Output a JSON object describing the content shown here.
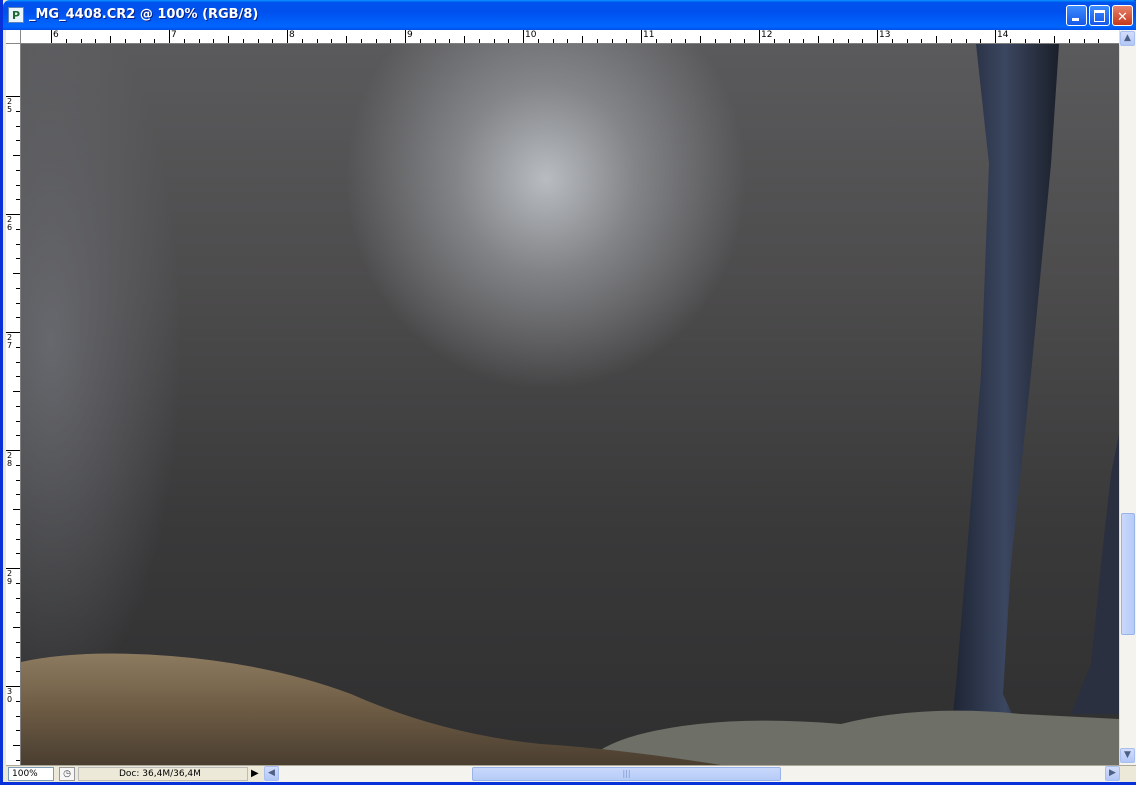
{
  "window": {
    "title": "_MG_4408.CR2 @ 100% (RGB/8)",
    "app_icon": "photoshop-document-icon",
    "buttons": {
      "minimize": "minimize-icon",
      "maximize": "maximize-icon",
      "close": "close-icon"
    }
  },
  "rulers": {
    "horizontal_labels": [
      "6",
      "7",
      "8",
      "9",
      "10",
      "11",
      "12",
      "13",
      "14"
    ],
    "vertical_labels": [
      "25",
      "26",
      "27",
      "28",
      "29",
      "30"
    ]
  },
  "canvas": {
    "image_description": "photo"
  },
  "status_bar": {
    "zoom": "100%",
    "doc_info": "Doc: 36,4M/36,4M",
    "menu_arrow": "▶"
  },
  "scrollbars": {
    "left_arrow": "◀",
    "right_arrow": "▶",
    "up_arrow": "▲",
    "down_arrow": "▼",
    "grip": "|||"
  },
  "colors": {
    "titlebar": "#0054e3",
    "close_button": "#c5381b",
    "chrome": "#ece9d8"
  }
}
